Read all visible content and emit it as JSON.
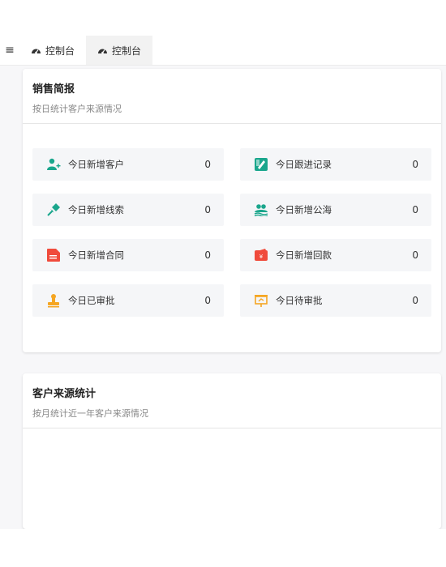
{
  "tabs": [
    {
      "label": "控制台",
      "icon": "dashboard-icon"
    },
    {
      "label": "控制台",
      "icon": "dashboard-icon"
    }
  ],
  "sales_card": {
    "title": "销售简报",
    "subtitle": "按日统计客户来源情况"
  },
  "stats": [
    {
      "label": "今日新增客户",
      "value": "0",
      "icon": "add-customer-icon",
      "color": "#1aa68c"
    },
    {
      "label": "今日跟进记录",
      "value": "0",
      "icon": "follow-record-icon",
      "color": "#1aa68c"
    },
    {
      "label": "今日新增线索",
      "value": "0",
      "icon": "pin-lead-icon",
      "color": "#1aa68c"
    },
    {
      "label": "今日新增公海",
      "value": "0",
      "icon": "public-pool-icon",
      "color": "#1aa68c"
    },
    {
      "label": "今日新增合同",
      "value": "0",
      "icon": "contract-icon",
      "color": "#f04b3c"
    },
    {
      "label": "今日新增回款",
      "value": "0",
      "icon": "wallet-icon",
      "color": "#f04b3c"
    },
    {
      "label": "今日已审批",
      "value": "0",
      "icon": "stamp-icon",
      "color": "#f5a623"
    },
    {
      "label": "今日待审批",
      "value": "0",
      "icon": "presentation-icon",
      "color": "#f5a623"
    }
  ],
  "source_card": {
    "title": "客户来源统计",
    "subtitle": "按月统计近一年客户来源情况"
  }
}
